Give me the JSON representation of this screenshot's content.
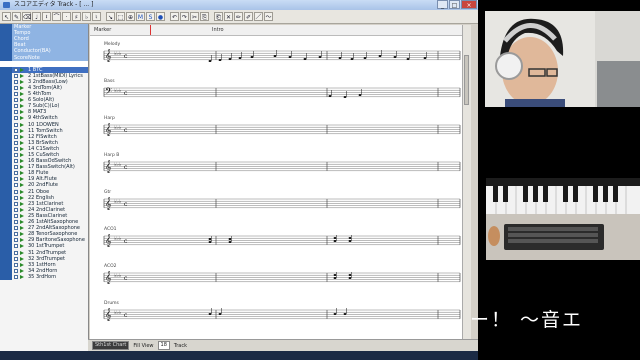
{
  "window": {
    "title": "スコアエディタ Track",
    "title_suffix": "- [ ... ]",
    "buttons": {
      "minimize": "_",
      "maximize": "□",
      "close": "×"
    }
  },
  "toolbar": {
    "icons": [
      "pointer-icon",
      "pencil-icon",
      "eraser-icon",
      "note-icon",
      "rest-icon",
      "tie-icon",
      "dot-icon",
      "sharp-icon",
      "flat-icon",
      "natural-icon",
      "cursor-icon",
      "select-icon",
      "zoom-icon",
      "mute-icon",
      "solo-icon",
      "record-icon",
      "undo-icon",
      "redo-icon",
      "cut-icon",
      "copy-icon",
      "paste-icon",
      "delete-icon",
      "pen-icon",
      "brush-icon",
      "line-icon",
      "curve-icon"
    ],
    "glyphs": [
      "↖",
      "✎",
      "⌫",
      "♩",
      "𝄽",
      "⌒",
      "·",
      "♯",
      "♭",
      "♮",
      "↘",
      "⬚",
      "⊕",
      "M",
      "S",
      "●",
      "↶",
      "↷",
      "✂",
      "⎘",
      "⎗",
      "✕",
      "✏",
      "✐",
      "／",
      "～"
    ]
  },
  "sidebar": {
    "top_items": [
      "Marker",
      "Tempo",
      "Chord",
      "Beat",
      "Conductor(BA)",
      "ScoreNote"
    ],
    "tracks": [
      "1 BTC",
      "2 1stBass(MIDI) Lyrics",
      "3 2ndBass(Low)",
      "4 3rdTom(Alt)",
      "5 4thTom",
      "6 Solo(Alt)",
      "7 Sub(C)(Lo)",
      "8 MAT3",
      "9 4thSwitch",
      "10 1DOWEN",
      "11 TomSwitch",
      "12 FlSwitch",
      "13 BrSwitch",
      "14 C1Switch",
      "15 CuSwitch",
      "16 BassOdSwitch",
      "17 BassSwitch(Alt)",
      "18 Flute",
      "19 Alt.Flute",
      "20 2ndFlute",
      "21 Oboe",
      "22 English",
      "23 1stClarinet",
      "24 2ndClarinet",
      "25 BassClarinet",
      "26 1stAltSaxophone",
      "27 2ndAltSaxophone",
      "28 TenorSaxophone",
      "29 BaritoneSaxophone",
      "30 1stTrumpet",
      "31 2ndTrumpet",
      "32 3rdTrumpet",
      "33 1stHorn",
      "34 2ndHorn",
      "35 3rdHorn"
    ]
  },
  "ruler": {
    "marks": [
      "Marker",
      "Intro"
    ]
  },
  "staves": [
    {
      "name": "Melody"
    },
    {
      "name": "Bass"
    },
    {
      "name": "Harp"
    },
    {
      "name": "Harp B"
    },
    {
      "name": "Gtr"
    },
    {
      "name": "ACO1"
    },
    {
      "name": "ACO2"
    },
    {
      "name": "Drums"
    }
  ],
  "statusbar": {
    "mode": "Sth1st Chart",
    "view_label": "Fill View",
    "zoom": "18",
    "track_label": "Track"
  },
  "caption": {
    "text": "ー！ 〜音エ"
  },
  "colors": {
    "accent": "#3f6fc1",
    "sidebar_header": "#8fb4e3",
    "close_button": "#c9463d"
  }
}
